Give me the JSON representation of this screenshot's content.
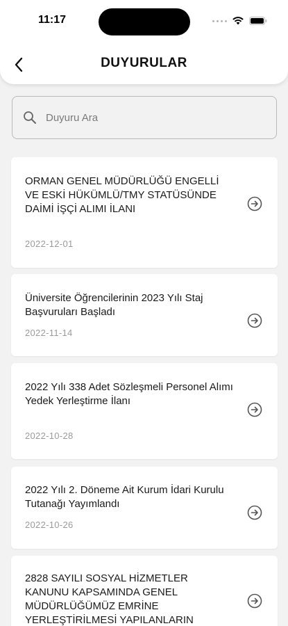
{
  "status_bar": {
    "time": "11:17"
  },
  "header": {
    "title": "DUYURULAR"
  },
  "search": {
    "placeholder": "Duyuru Ara",
    "value": ""
  },
  "announcements": [
    {
      "title": "ORMAN GENEL MÜDÜRLÜĞÜ ENGELLİ VE ESKİ HÜKÜMLÜ/TMY STATÜSÜNDE DAİMİ İŞÇİ ALIMI İLANI",
      "date": "2022-12-01"
    },
    {
      "title": "Üniversite Öğrencilerinin 2023 Yılı Staj Başvuruları Başladı",
      "date": "2022-11-14"
    },
    {
      "title": "2022 Yılı 338 Adet Sözleşmeli Personel Alımı Yedek Yerleştirme İlanı",
      "date": "2022-10-28"
    },
    {
      "title": "2022 Yılı 2. Döneme Ait Kurum İdari Kurulu Tutanağı Yayımlandı",
      "date": "2022-10-26"
    },
    {
      "title": "2828 SAYILI SOSYAL HİZMETLER KANUNU KAPSAMINDA GENEL MÜDÜRLÜĞÜMÜZ EMRİNE YERLEŞTİRİLMESİ YAPILANLARIN",
      "date": ""
    }
  ],
  "icons": {
    "back": "chevron-left-icon",
    "search": "search-icon",
    "card_arrow": "arrow-right-circle-icon"
  },
  "colors": {
    "background": "#f2f2f2",
    "card": "#ffffff",
    "date": "#9a9a9a"
  }
}
